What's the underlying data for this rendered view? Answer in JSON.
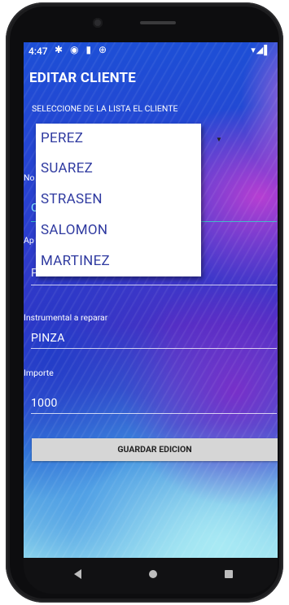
{
  "status_bar": {
    "time": "4:47",
    "left_icons": "✱ ◉ ▮ ⊕",
    "right_icons": "▾◢▌"
  },
  "header": {
    "title": "EDITAR CLIENTE",
    "subtitle": "SELECCIONE DE LA LISTA EL CLIENTE"
  },
  "spinner": {
    "arrow_icon": "▼",
    "options": [
      "PEREZ",
      "SUAREZ",
      "STRASEN",
      "SALOMON",
      "MARTINEZ"
    ]
  },
  "form": {
    "nombre_label": "No",
    "nombre_value": "C",
    "apellido_label": "Ap",
    "apellido_value": "PEREZ",
    "instrumental_label": "Instrumental a reparar",
    "instrumental_value": "PINZA",
    "importe_label": "Importe",
    "importe_value": "1000"
  },
  "buttons": {
    "save_label": "GUARDAR EDICION"
  }
}
